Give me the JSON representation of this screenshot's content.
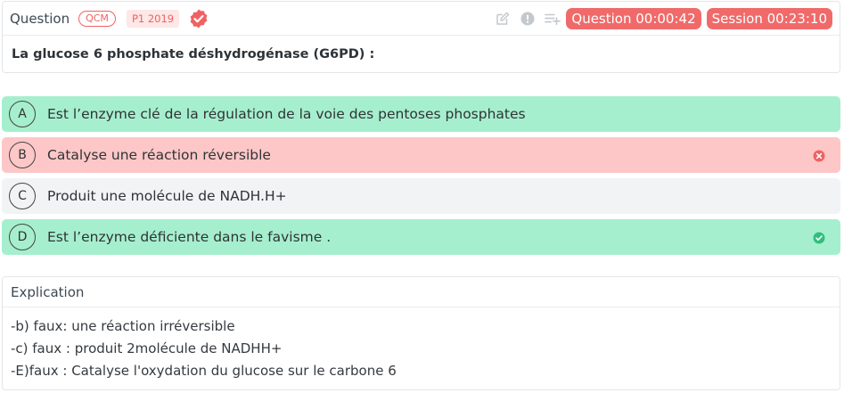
{
  "question": {
    "title": "Question",
    "type_badge": "QCM",
    "year_badge": "P1 2019",
    "timer_question": "Question 00:00:42",
    "timer_session": "Session 00:23:10",
    "text": "La glucose 6 phosphate déshydrogénase (G6PD) :"
  },
  "options": [
    {
      "letter": "A",
      "text": "Est l’enzyme clé de la régulation de la voie des pentoses phosphates",
      "state": "correct"
    },
    {
      "letter": "B",
      "text": "Catalyse une réaction réversible",
      "state": "wrong-selected"
    },
    {
      "letter": "C",
      "text": "Produit une molécule de NADH.H+",
      "state": "neutral"
    },
    {
      "letter": "D",
      "text": "Est l’enzyme déficiente dans le favisme .",
      "state": "correct-selected"
    }
  ],
  "explanation": {
    "title": "Explication",
    "lines": [
      "-b) faux: une réaction irréversible",
      "-c) faux : produit 2molécule de NADHH+",
      "-E)faux : Catalyse l'oxydation du glucose sur le carbone 6"
    ]
  },
  "colors": {
    "accent": "#f06a6a",
    "correct_bg": "#a6efce",
    "wrong_bg": "#fdc7c7",
    "neutral_bg": "#f2f3f5",
    "check": "#2fbf7e",
    "cross": "#f06262"
  },
  "icons": [
    "verified-badge-icon",
    "edit-icon",
    "alert-icon",
    "add-to-list-icon",
    "x-circle-icon",
    "check-circle-icon"
  ]
}
